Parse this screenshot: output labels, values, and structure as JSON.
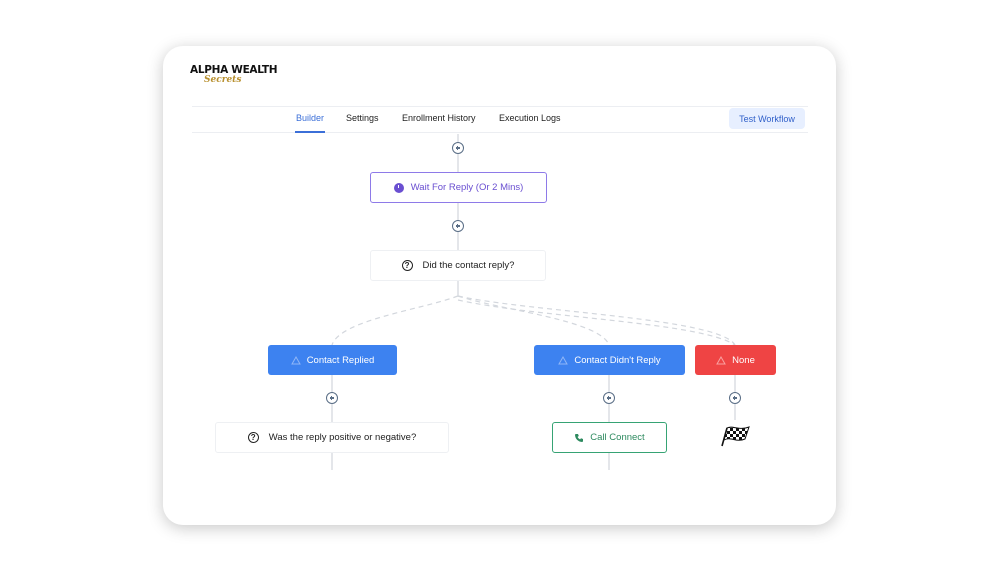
{
  "brand": {
    "line1": "ALPHA WEALTH",
    "line2": "Secrets"
  },
  "tabs": [
    {
      "label": "Builder",
      "active": true
    },
    {
      "label": "Settings",
      "active": false
    },
    {
      "label": "Enrollment History",
      "active": false
    },
    {
      "label": "Execution Logs",
      "active": false
    }
  ],
  "test_workflow_label": "Test Workflow",
  "nodes": {
    "wait": {
      "label": "Wait For Reply (Or 2 Mins)",
      "icon": "clock-icon"
    },
    "question1": {
      "label": "Did the contact reply?",
      "icon": "question-icon"
    },
    "branch_replied": {
      "label": "Contact Replied",
      "icon": "warning-icon"
    },
    "branch_not_replied": {
      "label": "Contact Didn't Reply",
      "icon": "warning-icon"
    },
    "branch_none": {
      "label": "None",
      "icon": "warning-icon"
    },
    "question2": {
      "label": "Was the reply positive or negative?",
      "icon": "question-icon"
    },
    "call": {
      "label": "Call Connect",
      "icon": "phone-icon"
    },
    "end": {
      "icon": "finish-flag-icon"
    }
  },
  "colors": {
    "accent_blue": "#3d82f0",
    "branch_red": "#ef4444",
    "wait_purple": "#6a4fd1",
    "call_green": "#2d8a5f",
    "tab_active": "#3b6fd8"
  }
}
